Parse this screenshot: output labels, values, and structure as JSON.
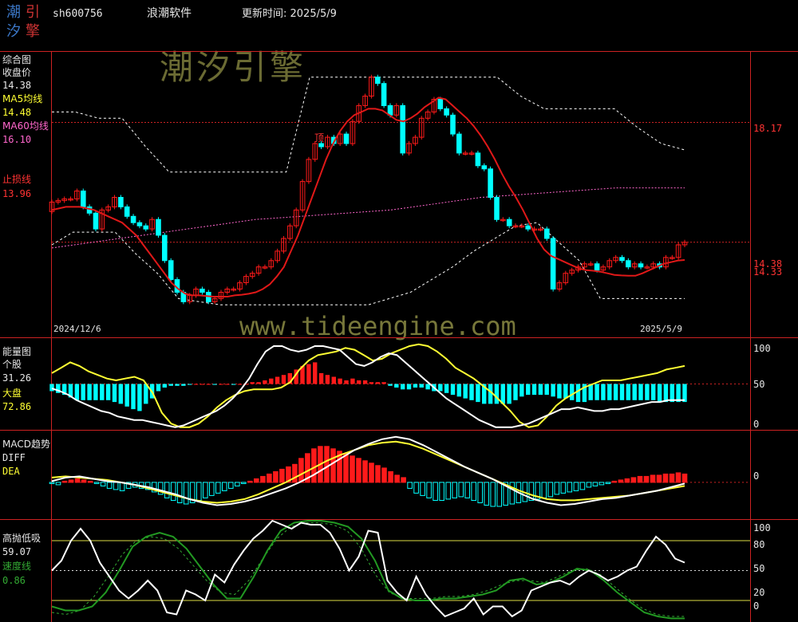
{
  "header": {
    "logo_chars": [
      "潮",
      "引",
      "汐",
      "擎"
    ],
    "code": "sh600756",
    "software": "浪潮软件",
    "update_label": "更新时间: 2025/5/9"
  },
  "watermark": {
    "brand": "潮汐引擎",
    "url": "www.tideengine.com"
  },
  "colors": {
    "up": "#ff1a1a",
    "down": "#00ffff",
    "white": "#ffffff",
    "yellow": "#ffff33",
    "pink": "#ff66cc",
    "green": "#33aa33",
    "axis_red": "#cc2222"
  },
  "chart_data": [
    {
      "type": "candlestick",
      "name": "综合图",
      "legend": [
        {
          "label": "收盘价",
          "value": "14.38",
          "color": "#ffffff"
        },
        {
          "label": "MA5均线",
          "value": "14.48",
          "color": "#ffff33"
        },
        {
          "label": "MA60均线",
          "value": "16.10",
          "color": "#ff66cc"
        },
        {
          "label": "止损线",
          "value": "13.96",
          "color": "#ff3333"
        }
      ],
      "right_labels": [
        "18.17",
        "14.38",
        "14.33"
      ],
      "date_start": "2024/12/6",
      "date_end": "2025/5/9",
      "annotation": "顶",
      "ylim": [
        11.4,
        20.4
      ],
      "closes": [
        15.65,
        15.7,
        15.75,
        15.75,
        16.0,
        15.5,
        15.3,
        14.8,
        15.4,
        15.5,
        15.8,
        15.5,
        15.2,
        15.0,
        14.9,
        14.8,
        15.1,
        14.6,
        13.8,
        13.2,
        12.8,
        12.5,
        12.7,
        12.9,
        12.8,
        12.5,
        12.6,
        12.8,
        12.9,
        12.9,
        13.1,
        13.3,
        13.4,
        13.6,
        13.6,
        13.8,
        14.1,
        14.5,
        14.9,
        15.4,
        16.3,
        17.0,
        17.5,
        17.4,
        17.7,
        17.5,
        17.8,
        17.5,
        18.2,
        18.7,
        19.0,
        19.6,
        19.4,
        18.7,
        18.4,
        18.7,
        17.2,
        17.5,
        17.7,
        18.3,
        18.5,
        18.9,
        18.6,
        18.4,
        17.8,
        17.2,
        17.2,
        17.2,
        16.8,
        16.7,
        15.8,
        15.1,
        15.1,
        14.9,
        14.9,
        14.9,
        14.8,
        14.8,
        14.8,
        14.5,
        12.9,
        13.1,
        13.4,
        13.5,
        13.6,
        13.7,
        13.7,
        13.5,
        13.6,
        13.8,
        13.9,
        13.8,
        13.6,
        13.7,
        13.6,
        13.6,
        13.7,
        13.6,
        13.9,
        13.9,
        14.3,
        14.38
      ],
      "ma_line": [
        15.4,
        15.45,
        15.5,
        15.5,
        15.5,
        15.45,
        15.4,
        15.3,
        15.2,
        15.1,
        15.0,
        14.8,
        14.6,
        14.3,
        14.0,
        13.7,
        13.4,
        13.1,
        12.9,
        12.75,
        12.7,
        12.7,
        12.68,
        12.66,
        12.66,
        12.66,
        12.7,
        12.72,
        12.75,
        12.8,
        12.9,
        13.05,
        13.3,
        13.6,
        14.1,
        14.6,
        15.2,
        15.8,
        16.4,
        17.0,
        17.5,
        17.9,
        18.2,
        18.4,
        18.5,
        18.6,
        18.6,
        18.55,
        18.4,
        18.25,
        18.2,
        18.3,
        18.45,
        18.65,
        18.8,
        18.95,
        18.9,
        18.7,
        18.5,
        18.3,
        18.05,
        17.75,
        17.4,
        17.0,
        16.55,
        16.15,
        15.8,
        15.4,
        14.95,
        14.5,
        14.15,
        13.95,
        13.85,
        13.75,
        13.65,
        13.55,
        13.5,
        13.48,
        13.45,
        13.4,
        13.35,
        13.33,
        13.32,
        13.32,
        13.4,
        13.5,
        13.6,
        13.7,
        13.75,
        13.8,
        13.82
      ],
      "ma60": [
        14.2,
        14.3,
        14.4,
        14.5,
        14.6,
        14.7,
        14.8,
        14.9,
        15.0,
        15.1,
        15.15,
        15.2,
        15.25,
        15.3,
        15.35,
        15.4,
        15.5,
        15.6,
        15.7,
        15.8,
        15.85,
        15.9,
        15.95,
        16.0,
        16.05,
        16.1,
        16.1,
        16.1,
        16.1
      ],
      "band_upper": [
        18.5,
        18.5,
        18.3,
        18.3,
        17.4,
        16.6,
        16.6,
        16.6,
        16.6,
        16.6,
        16.6,
        19.6,
        19.6,
        19.6,
        19.6,
        19.6,
        19.6,
        19.6,
        19.6,
        19.6,
        19.0,
        18.6,
        18.6,
        18.6,
        18.6,
        18.0,
        17.5,
        17.3
      ],
      "band_lower": [
        14.3,
        14.7,
        14.7,
        14.7,
        14.0,
        13.4,
        12.6,
        12.5,
        12.4,
        12.4,
        12.4,
        12.4,
        12.4,
        12.4,
        12.4,
        12.4,
        12.6,
        12.8,
        13.2,
        13.6,
        14.1,
        14.5,
        14.9,
        15.0,
        14.4,
        13.8,
        12.6,
        12.6,
        12.6,
        12.6,
        12.6
      ]
    },
    {
      "type": "bar_line",
      "name": "能量图",
      "legend": [
        {
          "label": "个股",
          "value": "31.26",
          "color": "#ffffff"
        },
        {
          "label": "大盘",
          "value": "72.86",
          "color": "#ffff33"
        }
      ],
      "y_ticks": [
        "100",
        "50",
        "0"
      ],
      "ylim": [
        0,
        100
      ],
      "bars": [
        -8,
        -10,
        -12,
        -15,
        -18,
        -18,
        -18,
        -18,
        -18,
        -18,
        -20,
        -22,
        -25,
        -28,
        -30,
        -22,
        -16,
        -8,
        -4,
        -2,
        -2,
        -2,
        -1,
        0,
        0,
        0,
        -1,
        0,
        0,
        -1,
        0,
        0,
        2,
        2,
        4,
        6,
        8,
        10,
        12,
        16,
        20,
        22,
        24,
        12,
        10,
        8,
        6,
        4,
        6,
        4,
        4,
        2,
        2,
        2,
        -2,
        -4,
        -6,
        -6,
        -4,
        -4,
        -6,
        -8,
        -8,
        -10,
        -12,
        -14,
        -16,
        -18,
        -20,
        -22,
        -22,
        -22,
        -22,
        -22,
        -18,
        -14,
        -12,
        -12,
        -12,
        -12,
        -14,
        -16,
        -16,
        -18,
        -20,
        -20,
        -18,
        -18,
        -18,
        -18,
        -18,
        -18,
        -18,
        -18,
        -18,
        -18,
        -18,
        -20,
        -20,
        -20,
        -20,
        -20
      ],
      "white": [
        45,
        42,
        38,
        32,
        28,
        24,
        20,
        18,
        14,
        12,
        10,
        10,
        8,
        6,
        4,
        2,
        4,
        8,
        12,
        16,
        20,
        26,
        34,
        44,
        56,
        72,
        86,
        92,
        92,
        88,
        86,
        88,
        92,
        92,
        90,
        88,
        80,
        72,
        70,
        74,
        80,
        84,
        82,
        74,
        66,
        58,
        50,
        42,
        34,
        28,
        22,
        16,
        10,
        6,
        2,
        2,
        2,
        4,
        6,
        10,
        14,
        18,
        22,
        22,
        24,
        22,
        20,
        20,
        22,
        22,
        24,
        26,
        28,
        30,
        30,
        32,
        32,
        32
      ],
      "yellow": [
        62,
        68,
        74,
        70,
        64,
        60,
        56,
        54,
        56,
        58,
        54,
        40,
        18,
        6,
        2,
        2,
        6,
        14,
        24,
        32,
        38,
        42,
        44,
        44,
        44,
        46,
        52,
        66,
        76,
        82,
        84,
        86,
        90,
        88,
        82,
        76,
        78,
        84,
        88,
        92,
        94,
        92,
        86,
        78,
        68,
        62,
        56,
        48,
        40,
        30,
        20,
        8,
        2,
        4,
        14,
        26,
        34,
        40,
        46,
        50,
        54,
        54,
        54,
        56,
        58,
        60,
        62,
        66,
        68,
        70
      ]
    },
    {
      "type": "bar_line",
      "name": "MACD趋势",
      "legend": [
        {
          "label": "DIFF",
          "value": "",
          "color": "#ffffff"
        },
        {
          "label": "DEA",
          "value": "",
          "color": "#ffff33"
        }
      ],
      "y_ticks": [
        "0"
      ],
      "ylim": [
        -0.6,
        0.85
      ],
      "bars": [
        -0.02,
        -0.04,
        0.02,
        0.04,
        0.06,
        0.04,
        0.02,
        -0.02,
        -0.06,
        -0.1,
        -0.12,
        -0.14,
        -0.1,
        -0.08,
        -0.1,
        -0.12,
        -0.16,
        -0.2,
        -0.26,
        -0.3,
        -0.34,
        -0.36,
        -0.34,
        -0.3,
        -0.26,
        -0.22,
        -0.18,
        -0.14,
        -0.1,
        -0.06,
        -0.02,
        0.02,
        0.06,
        0.1,
        0.14,
        0.18,
        0.22,
        0.26,
        0.3,
        0.4,
        0.48,
        0.56,
        0.6,
        0.6,
        0.56,
        0.52,
        0.48,
        0.44,
        0.4,
        0.36,
        0.32,
        0.28,
        0.24,
        0.18,
        0.12,
        0.08,
        -0.1,
        -0.18,
        -0.22,
        -0.26,
        -0.3,
        -0.3,
        -0.28,
        -0.26,
        -0.24,
        -0.26,
        -0.3,
        -0.34,
        -0.38,
        -0.4,
        -0.4,
        -0.38,
        -0.36,
        -0.34,
        -0.32,
        -0.3,
        -0.28,
        -0.26,
        -0.24,
        -0.2,
        -0.18,
        -0.16,
        -0.14,
        -0.12,
        -0.08,
        -0.06,
        -0.04,
        -0.02,
        0.02,
        0.04,
        0.06,
        0.08,
        0.1,
        0.1,
        0.12,
        0.12,
        0.14,
        0.14,
        0.16,
        0.14
      ],
      "white": [
        0.02,
        0.08,
        0.1,
        0.06,
        0.02,
        0.0,
        -0.04,
        -0.08,
        -0.14,
        -0.2,
        -0.28,
        -0.34,
        -0.38,
        -0.36,
        -0.32,
        -0.26,
        -0.18,
        -0.1,
        0.0,
        0.12,
        0.26,
        0.4,
        0.54,
        0.64,
        0.72,
        0.76,
        0.72,
        0.62,
        0.5,
        0.38,
        0.26,
        0.16,
        0.06,
        -0.06,
        -0.18,
        -0.28,
        -0.34,
        -0.38,
        -0.36,
        -0.32,
        -0.28,
        -0.26,
        -0.22,
        -0.18,
        -0.14,
        -0.08,
        -0.02
      ],
      "yellow": [
        0.08,
        0.1,
        0.08,
        0.06,
        0.04,
        0.0,
        -0.04,
        -0.1,
        -0.16,
        -0.22,
        -0.28,
        -0.32,
        -0.34,
        -0.32,
        -0.28,
        -0.2,
        -0.1,
        0.0,
        0.12,
        0.24,
        0.36,
        0.46,
        0.54,
        0.62,
        0.66,
        0.68,
        0.64,
        0.56,
        0.46,
        0.36,
        0.26,
        0.16,
        0.06,
        -0.04,
        -0.14,
        -0.22,
        -0.28,
        -0.3,
        -0.3,
        -0.28,
        -0.26,
        -0.24,
        -0.22,
        -0.18,
        -0.14,
        -0.1,
        -0.06
      ]
    },
    {
      "type": "line",
      "name": "高抛低吸",
      "legend": [
        {
          "label": "59.07",
          "value": "",
          "color": "#ffffff"
        },
        {
          "label": "速度线",
          "value": "",
          "color": "#33aa33"
        },
        {
          "label": "0.86",
          "value": "",
          "color": "#33aa33"
        }
      ],
      "y_ticks": [
        "100",
        "80",
        "50",
        "20",
        "0"
      ],
      "ylim": [
        0,
        100
      ],
      "white": [
        50,
        60,
        80,
        92,
        80,
        58,
        44,
        30,
        22,
        30,
        40,
        30,
        8,
        6,
        30,
        26,
        20,
        46,
        38,
        56,
        70,
        82,
        90,
        100,
        96,
        92,
        98,
        96,
        96,
        88,
        72,
        50,
        64,
        90,
        88,
        40,
        28,
        20,
        44,
        26,
        14,
        4,
        8,
        12,
        22,
        6,
        14,
        14,
        4,
        10,
        30,
        34,
        38,
        40,
        36,
        44,
        50,
        46,
        40,
        44,
        50,
        54,
        70,
        84,
        76,
        62,
        58
      ],
      "green_solid": [
        14,
        10,
        10,
        14,
        28,
        50,
        74,
        84,
        88,
        84,
        72,
        54,
        36,
        22,
        22,
        44,
        70,
        90,
        98,
        100,
        100,
        98,
        94,
        82,
        60,
        30,
        22,
        20,
        20,
        22,
        22,
        24,
        26,
        30,
        40,
        42,
        36,
        38,
        44,
        52,
        50,
        40,
        28,
        18,
        8,
        4,
        2,
        2
      ],
      "green_dashed": [
        8,
        6,
        10,
        24,
        44,
        66,
        80,
        84,
        82,
        72,
        56,
        40,
        28,
        26,
        40,
        62,
        82,
        94,
        98,
        98,
        96,
        90,
        72,
        46,
        28,
        22,
        22,
        22,
        24,
        24,
        26,
        30,
        36,
        40,
        40,
        38,
        44,
        50,
        52,
        46,
        34,
        22,
        12,
        6,
        4,
        4
      ]
    }
  ]
}
